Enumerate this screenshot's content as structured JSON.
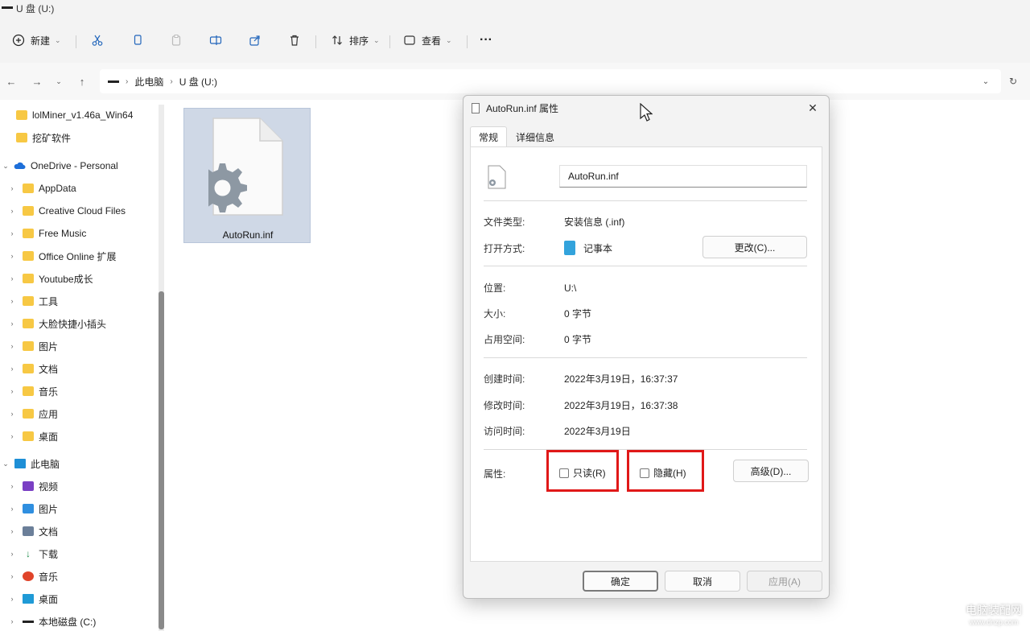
{
  "window": {
    "title": "U 盘 (U:)"
  },
  "toolbar": {
    "new_label": "新建",
    "sort_label": "排序",
    "view_label": "查看",
    "more_label": "···"
  },
  "address": {
    "crumbs": [
      "此电脑",
      "U 盘 (U:)"
    ]
  },
  "sidebar": {
    "items": [
      {
        "label": "lolMiner_v1.46a_Win64",
        "icon": "folder"
      },
      {
        "label": "挖矿软件",
        "icon": "folder"
      },
      {
        "label": "OneDrive - Personal",
        "icon": "cloud"
      },
      {
        "label": "AppData",
        "icon": "folder"
      },
      {
        "label": "Creative Cloud Files",
        "icon": "folder"
      },
      {
        "label": "Free Music",
        "icon": "folder"
      },
      {
        "label": "Office Online 扩展",
        "icon": "folder"
      },
      {
        "label": "Youtube成长",
        "icon": "folder"
      },
      {
        "label": "工具",
        "icon": "folder"
      },
      {
        "label": "大脸快捷小插头",
        "icon": "folder"
      },
      {
        "label": "图片",
        "icon": "folder"
      },
      {
        "label": "文档",
        "icon": "folder"
      },
      {
        "label": "音乐",
        "icon": "folder"
      },
      {
        "label": "应用",
        "icon": "folder"
      },
      {
        "label": "桌面",
        "icon": "folder"
      },
      {
        "label": "此电脑",
        "icon": "monitor"
      },
      {
        "label": "视频",
        "icon": "video"
      },
      {
        "label": "图片",
        "icon": "pictures"
      },
      {
        "label": "文档",
        "icon": "documents"
      },
      {
        "label": "下载",
        "icon": "download"
      },
      {
        "label": "音乐",
        "icon": "music"
      },
      {
        "label": "桌面",
        "icon": "desktop"
      },
      {
        "label": "本地磁盘 (C:)",
        "icon": "drive"
      }
    ]
  },
  "file": {
    "name": "AutoRun.inf"
  },
  "dialog": {
    "title": "AutoRun.inf 属性",
    "tabs": [
      "常规",
      "详细信息"
    ],
    "filename": "AutoRun.inf",
    "type_label": "文件类型:",
    "type_value": "安装信息 (.inf)",
    "openwith_label": "打开方式:",
    "openwith_value": "记事本",
    "change_button": "更改(C)...",
    "location_label": "位置:",
    "location_value": "U:\\",
    "size_label": "大小:",
    "size_value": "0 字节",
    "disk_label": "占用空间:",
    "disk_value": "0 字节",
    "created_label": "创建时间:",
    "created_value": "2022年3月19日，16:37:37",
    "modified_label": "修改时间:",
    "modified_value": "2022年3月19日，16:37:38",
    "accessed_label": "访问时间:",
    "accessed_value": "2022年3月19日",
    "attributes_label": "属性:",
    "readonly_label": "只读(R)",
    "hidden_label": "隐藏(H)",
    "advanced_button": "高级(D)...",
    "ok_button": "确定",
    "cancel_button": "取消",
    "apply_button": "应用(A)"
  },
  "watermark": {
    "line1": "电脑装配网",
    "line2": "www.dnzp.com"
  },
  "colors": {
    "highlight": "#e01818",
    "folder": "#f7c844"
  }
}
